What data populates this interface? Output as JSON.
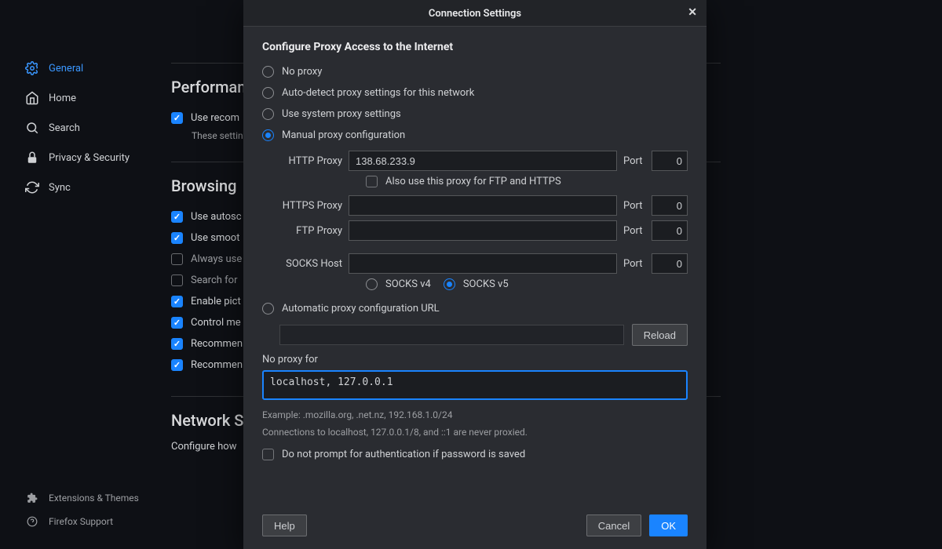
{
  "sidebar": {
    "items": [
      {
        "label": "General"
      },
      {
        "label": "Home"
      },
      {
        "label": "Search"
      },
      {
        "label": "Privacy & Security"
      },
      {
        "label": "Sync"
      }
    ],
    "bottom": [
      {
        "label": "Extensions & Themes"
      },
      {
        "label": "Firefox Support"
      }
    ]
  },
  "main": {
    "performance": {
      "title": "Performance",
      "use_recommended": "Use recom",
      "hint": "These settin"
    },
    "browsing": {
      "title": "Browsing",
      "rows": [
        {
          "label": "Use autosc",
          "checked": true
        },
        {
          "label": "Use smoot",
          "checked": true
        },
        {
          "label": "Always use",
          "checked": false
        },
        {
          "label": "Search for",
          "checked": false
        },
        {
          "label": "Enable pict",
          "checked": true
        },
        {
          "label": "Control me",
          "checked": true
        },
        {
          "label": "Recommen",
          "checked": true
        },
        {
          "label": "Recommen",
          "checked": true
        }
      ]
    },
    "network": {
      "title": "Network Se",
      "desc": "Configure how"
    }
  },
  "modal": {
    "title": "Connection Settings",
    "heading": "Configure Proxy Access to the Internet",
    "radios": {
      "no_proxy": "No proxy",
      "auto_detect": "Auto-detect proxy settings for this network",
      "system": "Use system proxy settings",
      "manual": "Manual proxy configuration",
      "pac": "Automatic proxy configuration URL"
    },
    "http": {
      "label": "HTTP Proxy",
      "value": "138.68.233.9",
      "port_label": "Port",
      "port": "0"
    },
    "also_ftp_https": "Also use this proxy for FTP and HTTPS",
    "https": {
      "label": "HTTPS Proxy",
      "value": "",
      "port_label": "Port",
      "port": "0"
    },
    "ftp": {
      "label": "FTP Proxy",
      "value": "",
      "port_label": "Port",
      "port": "0"
    },
    "socks": {
      "label": "SOCKS Host",
      "value": "",
      "port_label": "Port",
      "port": "0",
      "v4": "SOCKS v4",
      "v5": "SOCKS v5"
    },
    "pac_value": "",
    "reload": "Reload",
    "no_proxy_for_label": "No proxy for",
    "no_proxy_for_value": "localhost, 127.0.0.1",
    "example": "Example: .mozilla.org, .net.nz, 192.168.1.0/24",
    "never_proxied": "Connections to localhost, 127.0.0.1/8, and ::1 are never proxied.",
    "dont_prompt": "Do not prompt for authentication if password is saved",
    "help": "Help",
    "cancel": "Cancel",
    "ok": "OK"
  }
}
